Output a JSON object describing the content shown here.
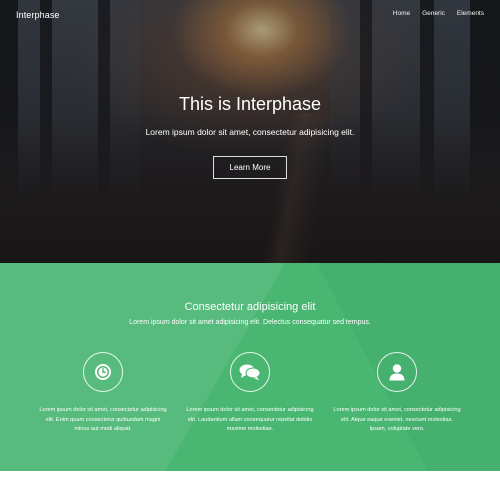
{
  "header": {
    "logo": "Interphase",
    "nav": [
      {
        "label": "Home"
      },
      {
        "label": "Generic"
      },
      {
        "label": "Elements"
      }
    ]
  },
  "hero": {
    "title": "This is Interphase",
    "subtitle": "Lorem ipsum dolor sit amet, consectetur adipisicing elit.",
    "button_label": "Learn More"
  },
  "features": {
    "title": "Consectetur adipisicing elit",
    "subtitle": "Lorem ipsum dolor sit amet adipisicing elit. Delectus consequatur sed tempus.",
    "accent_color": "#49b672",
    "items": [
      {
        "icon": "clock-icon",
        "text": "Lorem ipsum dolor sit amet, consectetur adipisicing elit. Enim quam consectetur quibusdam magni minus aut modi aliquid."
      },
      {
        "icon": "comments-icon",
        "text": "Lorem ipsum dolor sit amet, consectetur adipisicing elit. Laudantium ullam consequatur repellat debitis maxime molestiae."
      },
      {
        "icon": "user-icon",
        "text": "Lorem ipsum dolor sit amet, consectetur adipisicing elit. Atque eaque eveniet, nesciunt molestias. Ipsam, voluptate vero."
      }
    ]
  }
}
